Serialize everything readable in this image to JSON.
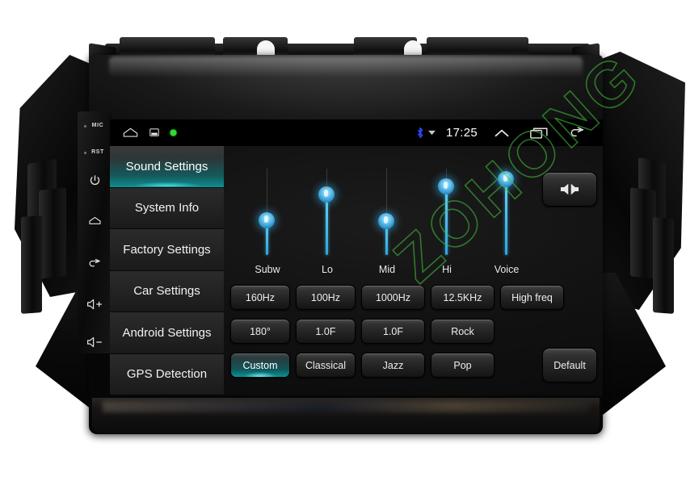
{
  "device": {
    "hardware_buttons": [
      {
        "name": "mic",
        "label": "MIC"
      },
      {
        "name": "reset",
        "label": "RST"
      },
      {
        "name": "power",
        "label": "",
        "icon": "power-icon"
      },
      {
        "name": "home",
        "label": "",
        "icon": "home-icon"
      },
      {
        "name": "back",
        "label": "",
        "icon": "back-icon"
      },
      {
        "name": "volume-up",
        "label": "+",
        "icon": "volume-up-icon"
      },
      {
        "name": "volume-down",
        "label": "-",
        "icon": "volume-down-icon"
      }
    ],
    "watermark": "ZOHONG"
  },
  "statusbar": {
    "home_icon": "home-outline-icon",
    "screenshot_icon": "screenshot-icon",
    "green_icon": "green-indicator-icon",
    "bluetooth_icon": "bluetooth-icon",
    "dropdown_icon": "caret-down-icon",
    "clock": "17:25",
    "expand_icon": "chevron-up-icon",
    "recents_icon": "recents-icon",
    "back_icon": "back-arrow-icon"
  },
  "sidebar": {
    "items": [
      {
        "label": "Sound Settings",
        "selected": true
      },
      {
        "label": "System Info",
        "selected": false
      },
      {
        "label": "Factory Settings",
        "selected": false
      },
      {
        "label": "Car Settings",
        "selected": false
      },
      {
        "label": "Android Settings",
        "selected": false
      },
      {
        "label": "GPS Detection",
        "selected": false
      }
    ]
  },
  "equalizer": {
    "balance_button": {
      "name": "balance-fader-button",
      "icon": "balance-speakers-icon"
    },
    "default_button": {
      "label": "Default"
    },
    "sliders": [
      {
        "label": "Subw",
        "value": 45
      },
      {
        "label": "Lo",
        "value": 78
      },
      {
        "label": "Mid",
        "value": 44
      },
      {
        "label": "Hi",
        "value": 88
      },
      {
        "label": "Voice",
        "value": 97
      }
    ],
    "row_freq": [
      {
        "label": "160Hz",
        "selected": false
      },
      {
        "label": "100Hz",
        "selected": false
      },
      {
        "label": "1000Hz",
        "selected": false
      },
      {
        "label": "12.5KHz",
        "selected": false
      },
      {
        "label": "High freq",
        "selected": false
      }
    ],
    "row_params": [
      {
        "label": "180°",
        "selected": false
      },
      {
        "label": "1.0F",
        "selected": false
      },
      {
        "label": "1.0F",
        "selected": false
      },
      {
        "label": "Rock",
        "selected": false
      }
    ],
    "row_presets": [
      {
        "label": "Custom",
        "selected": true
      },
      {
        "label": "Classical",
        "selected": false
      },
      {
        "label": "Jazz",
        "selected": false
      },
      {
        "label": "Pop",
        "selected": false
      }
    ]
  },
  "colors": {
    "accent_teal": "#0a9296",
    "slider_blue": "#4fb4e4",
    "watermark_green": "#40be3c"
  }
}
